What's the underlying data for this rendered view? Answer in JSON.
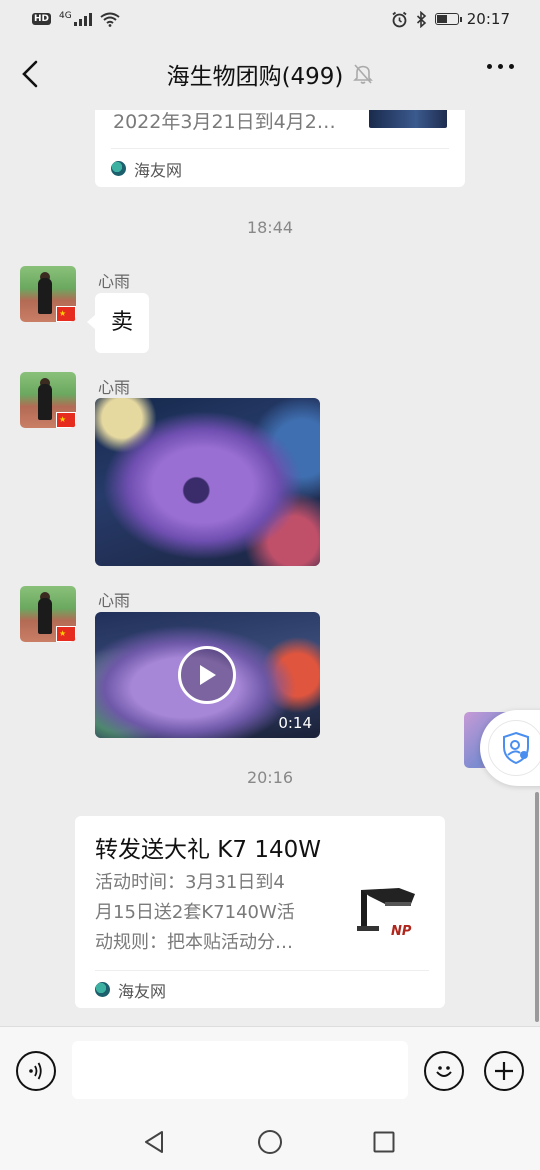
{
  "status_bar": {
    "hd": "HD",
    "network": "4G",
    "time": "20:17",
    "battery_level": 0.55
  },
  "header": {
    "title": "海生物团购(499)"
  },
  "messages": {
    "top_card": {
      "text": "2022年3月21日到4月2…",
      "source": "海友网"
    },
    "time_1": "18:44",
    "msg_text": {
      "sender": "心雨",
      "text": "卖"
    },
    "msg_photo": {
      "sender": "心雨"
    },
    "msg_video": {
      "sender": "心雨",
      "duration": "0:14"
    },
    "time_2": "20:16",
    "share_card": {
      "title": "转发送大礼 K7 140W",
      "desc_line1": "活动时间：3月31日到4",
      "desc_line2": "月15日送2套K7140W活",
      "desc_line3": "动规则：把本贴活动分…",
      "thumb_logo": "NP",
      "source": "海友网"
    }
  },
  "input_bar": {
    "placeholder": ""
  },
  "colors": {
    "background": "#ededed",
    "bubble": "#ffffff",
    "muted_text": "#7a7a7a",
    "badge_blue": "#4a8ef0"
  }
}
